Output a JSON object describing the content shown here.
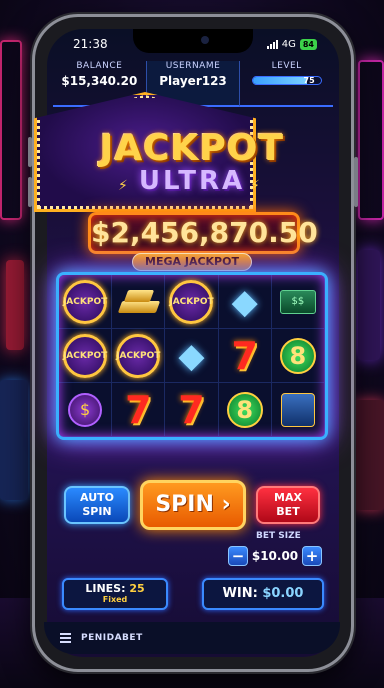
{
  "status_bar": {
    "time": "21:38",
    "network": "4G",
    "battery": "84"
  },
  "header": {
    "balance_label": "BALANCE",
    "balance_value": "$15,340.20",
    "username_label": "USERNAME",
    "username_value": "Player123",
    "level_label": "LEVEL",
    "level_value": "75",
    "level_progress": 0.8
  },
  "logo": {
    "line1": "JACKPOT",
    "line2": "ULTRA"
  },
  "jackpot": {
    "amount": "$2,456,870.50",
    "label": "MEGA JACKPOT"
  },
  "reels": {
    "symbols": [
      [
        "jackpot-coin",
        "gold-bars",
        "jackpot-coin",
        "diamond",
        "cash-stack"
      ],
      [
        "jackpot-coin",
        "jackpot-coin",
        "diamond",
        "lucky-seven",
        "green-eight"
      ],
      [
        "money-bag",
        "lucky-seven",
        "lucky-seven",
        "green-eight",
        "blue-chest"
      ]
    ],
    "coin_text": "JACKPOT"
  },
  "controls": {
    "auto_spin_line1": "AUTO",
    "auto_spin_line2": "SPIN",
    "spin_label": "SPIN",
    "spin_arrow": "›",
    "max_bet_line1": "MAX",
    "max_bet_line2": "BET",
    "bet_size_label": "BET SIZE",
    "bet_value": "$10.00",
    "minus": "−",
    "plus": "+"
  },
  "footer_stats": {
    "lines_label": "LINES:",
    "lines_value": "25",
    "lines_mode": "Fixed",
    "win_label": "WIN:",
    "win_value": "$0.00"
  },
  "bottom_bar": {
    "brand": "PENIDABET"
  },
  "colors": {
    "accent_blue": "#3a8aff",
    "accent_orange": "#ff8a00",
    "accent_gold": "#ffd040",
    "accent_red": "#ff3040"
  }
}
